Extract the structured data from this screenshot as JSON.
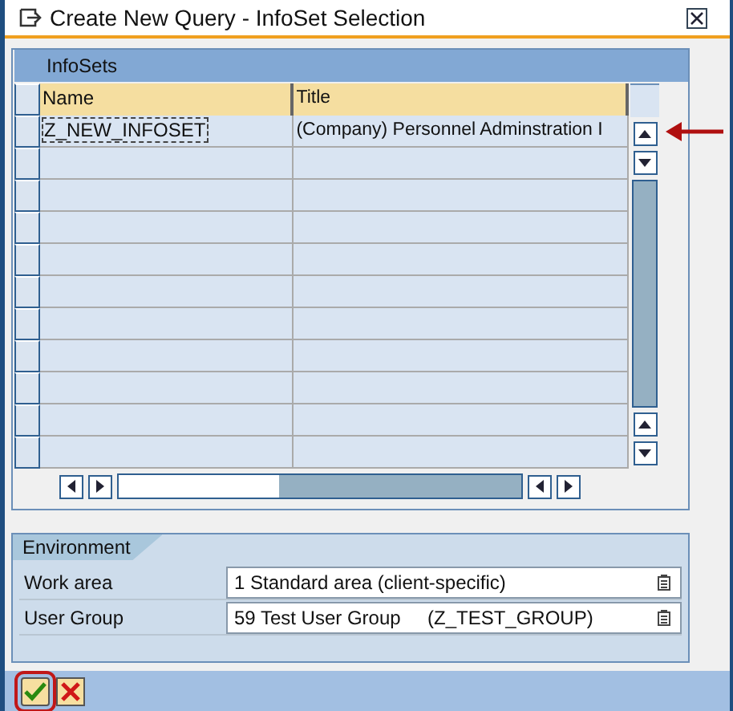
{
  "window": {
    "title": "Create New Query - InfoSet Selection"
  },
  "infosets": {
    "title": "InfoSets",
    "columns": [
      "Name",
      "Title"
    ],
    "rows": [
      {
        "name": "Z_NEW_INFOSET",
        "title": "(Company) Personnel Adminstration I",
        "focused": true
      }
    ]
  },
  "environment": {
    "title": "Environment",
    "fields": [
      {
        "label": "Work area",
        "value": "1 Standard area (client-specific)"
      },
      {
        "label": "User Group",
        "value": "59 Test User Group     (Z_TEST_GROUP)"
      }
    ]
  },
  "toolbar": {
    "buttons": [
      {
        "kind": "confirm",
        "highlighted": true
      },
      {
        "kind": "cancel",
        "highlighted": false
      }
    ]
  }
}
